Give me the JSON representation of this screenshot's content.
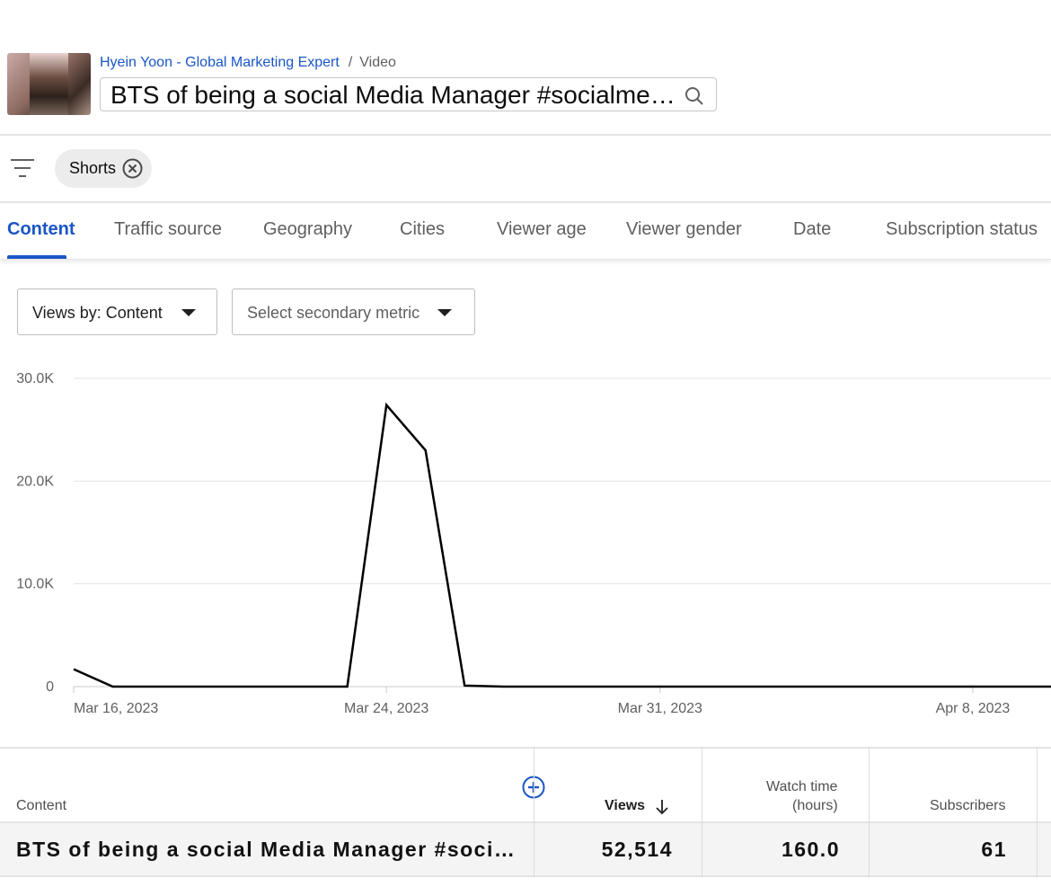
{
  "header": {
    "channel_name": "Hyein Yoon - Global Marketing Expert",
    "separator": "/",
    "current_page": "Video",
    "video_title": "BTS of being a social Media Manager #socialmedia…"
  },
  "filters": {
    "chip_label": "Shorts"
  },
  "tabs": [
    {
      "label": "Content"
    },
    {
      "label": "Traffic source"
    },
    {
      "label": "Geography"
    },
    {
      "label": "Cities"
    },
    {
      "label": "Viewer age"
    },
    {
      "label": "Viewer gender"
    },
    {
      "label": "Date"
    },
    {
      "label": "Subscription status"
    }
  ],
  "controls": {
    "primary_metric": "Views by: Content",
    "secondary_metric": "Select secondary metric"
  },
  "chart_data": {
    "type": "line",
    "title": "",
    "xlabel": "",
    "ylabel": "",
    "ylim": [
      0,
      30000
    ],
    "y_ticks": [
      0,
      10000,
      20000,
      30000
    ],
    "y_tick_labels": [
      "0",
      "10.0K",
      "20.0K",
      "30.0K"
    ],
    "x_tick_labels": [
      "Mar 16, 2023",
      "Mar 24, 2023",
      "Mar 31, 2023",
      "Apr 8, 2023"
    ],
    "x_tick_dates": [
      "2023-03-16",
      "2023-03-24",
      "2023-03-31",
      "2023-04-08"
    ],
    "x_range": [
      "2023-03-16",
      "2023-04-10"
    ],
    "grid": true,
    "series": [
      {
        "name": "",
        "color": "#000000",
        "x": [
          "2023-03-16",
          "2023-03-17",
          "2023-03-18",
          "2023-03-19",
          "2023-03-20",
          "2023-03-21",
          "2023-03-22",
          "2023-03-23",
          "2023-03-24",
          "2023-03-25",
          "2023-03-26",
          "2023-03-27",
          "2023-03-28",
          "2023-03-29",
          "2023-03-30",
          "2023-03-31",
          "2023-04-01",
          "2023-04-02",
          "2023-04-03",
          "2023-04-04",
          "2023-04-05",
          "2023-04-06",
          "2023-04-07",
          "2023-04-08",
          "2023-04-09",
          "2023-04-10"
        ],
        "values": [
          1700,
          0,
          0,
          0,
          0,
          0,
          0,
          0,
          27400,
          23000,
          100,
          0,
          0,
          0,
          0,
          0,
          0,
          0,
          0,
          0,
          0,
          0,
          0,
          0,
          0,
          0
        ]
      }
    ]
  },
  "table": {
    "headers": {
      "content": "Content",
      "views": "Views",
      "watch_time_line1": "Watch time",
      "watch_time_line2": "(hours)",
      "subscribers": "Subscribers"
    },
    "rows": [
      {
        "content": "BTS of being a social Media Manager #socialmedia…",
        "views": "52,514",
        "watch_time": "160.0",
        "subscribers": "61"
      }
    ]
  }
}
